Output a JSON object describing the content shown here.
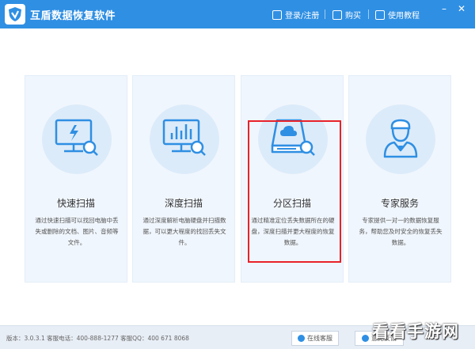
{
  "app": {
    "title": "互盾数据恢复软件"
  },
  "nav": {
    "login": "登录/注册",
    "buy": "购买",
    "tutorial": "使用教程"
  },
  "cards": [
    {
      "title": "快速扫描",
      "desc": "通过快速扫描可以找回电脑中丢失或删除的文档、图片、音频等文件。",
      "icon": "monitor-lightning-icon"
    },
    {
      "title": "深度扫描",
      "desc": "通过深度解析电脑硬盘并扫描数据，可以更大程度的找回丢失文件。",
      "icon": "monitor-chart-icon"
    },
    {
      "title": "分区扫描",
      "desc": "通过精准定位丢失数据所在的硬盘，深度扫描并更大程度的恢复数据。",
      "icon": "disk-cloud-icon"
    },
    {
      "title": "专家服务",
      "desc": "专家提供一对一的数据恢复服务，帮助您及时安全的恢复丢失数据。",
      "icon": "expert-person-icon"
    }
  ],
  "status": {
    "text": "版本：3.0.3.1  客服电话：400-888-1277   客服QQ：400 671 8068"
  },
  "buttons": {
    "online_service": "在线客服",
    "feedback": "意见反馈"
  },
  "watermark": "看看手游网",
  "colors": {
    "accent": "#2f8fe3",
    "highlight": "#e8222a",
    "card_bg": "#f0f6fd"
  }
}
